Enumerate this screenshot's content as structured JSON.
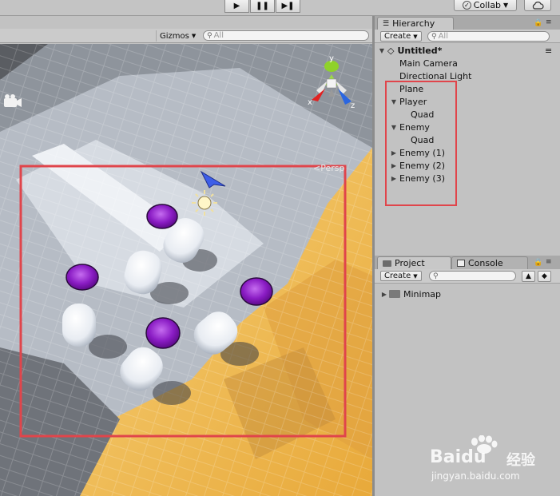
{
  "toolbar": {
    "play_icon": "play-icon",
    "pause_icon": "pause-icon",
    "step_icon": "step-icon",
    "collab_label": "Collab",
    "cloud_icon": "cloud-icon"
  },
  "scene": {
    "gizmos_label": "Gizmos",
    "search_placeholder": "All",
    "view_label": "Persp",
    "axis_labels": {
      "x": "x",
      "y": "y",
      "z": "z"
    }
  },
  "hierarchy": {
    "tab_label": "Hierarchy",
    "create_label": "Create",
    "search_placeholder": "All",
    "scene_name": "Untitled*",
    "items": [
      {
        "label": "Main Camera"
      },
      {
        "label": "Directional Light"
      },
      {
        "label": "Plane"
      },
      {
        "label": "Player"
      },
      {
        "label": "Quad"
      },
      {
        "label": "Enemy"
      },
      {
        "label": "Quad"
      },
      {
        "label": "Enemy (1)"
      },
      {
        "label": "Enemy (2)"
      },
      {
        "label": "Enemy (3)"
      }
    ]
  },
  "project": {
    "tab_label": "Project",
    "console_tab_label": "Console",
    "create_label": "Create",
    "items": [
      {
        "label": "Minimap"
      }
    ]
  },
  "watermark": {
    "brand": "Baidu",
    "brand_cn": "经验",
    "url": "jingyan.baidu.com"
  },
  "colors": {
    "highlight_red": "#e0454b",
    "enemy_purple": "#8a1cc4",
    "terrain_yellow": "#f2c25a",
    "axis_x_red": "#e02222",
    "axis_y_green": "#8fd12a",
    "axis_z_blue": "#2a66e0"
  }
}
